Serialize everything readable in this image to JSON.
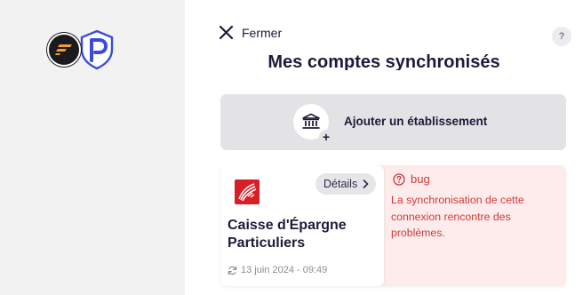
{
  "header": {
    "close_label": "Fermer",
    "help_label": "?",
    "title": "Mes comptes synchronisés"
  },
  "add_bank": {
    "label": "Ajouter un établissement",
    "plus": "+"
  },
  "account": {
    "name": "Caisse d'Épargne Particuliers",
    "details_label": "Détails",
    "last_sync": "13 juin 2024 - 09:49",
    "status": {
      "label": "bug",
      "message": "La synchronisation de cette connexion rencontre des problèmes."
    }
  },
  "colors": {
    "sidebar_bg": "#f2f2f3",
    "error_red": "#cf3a3a",
    "error_bg": "#fdeceb",
    "bank_red": "#d91f26",
    "brand_blue": "#3a4bdc"
  },
  "icons": [
    "close-icon",
    "help-icon",
    "bank-building-icon",
    "plus-icon",
    "chevron-right-icon",
    "sync-icon",
    "warning-icon"
  ]
}
